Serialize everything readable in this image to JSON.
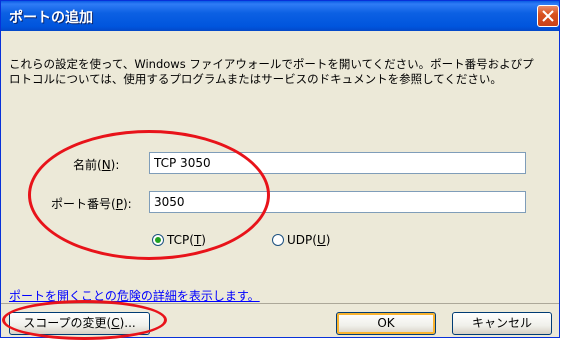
{
  "dialog": {
    "title": "ポートの追加",
    "description": "これらの設定を使って、Windows ファイアウォールでポートを開いてください。ポート番号およびプ\nロトコルについては、使用するプログラムまたはサービスのドキュメントを参照してください。"
  },
  "fields": {
    "name_label": "名前(",
    "name_accel": "N",
    "name_suffix": "):",
    "name_value": "TCP 3050",
    "port_label": "ポート番号(",
    "port_accel": "P",
    "port_suffix": "):",
    "port_value": "3050"
  },
  "protocol": {
    "tcp_label": "TCP(",
    "tcp_accel": "T",
    "tcp_suffix": ")",
    "udp_label": "UDP(",
    "udp_accel": "U",
    "udp_suffix": ")",
    "selected": "TCP"
  },
  "link": {
    "text": "ポートを開くことの危険の詳細を表示します。"
  },
  "buttons": {
    "scope_label": "スコープの変更(",
    "scope_accel": "C",
    "scope_suffix": ")...",
    "ok_label": "OK",
    "cancel_label": "キャンセル"
  },
  "colors": {
    "titlebar": "#0055dd",
    "dialog_background": "#ece9d8",
    "annotation_ellipse": "#e8131a",
    "link": "#0000ff",
    "radio_selected": "#21a121"
  },
  "icons": {
    "close": "close-icon"
  }
}
